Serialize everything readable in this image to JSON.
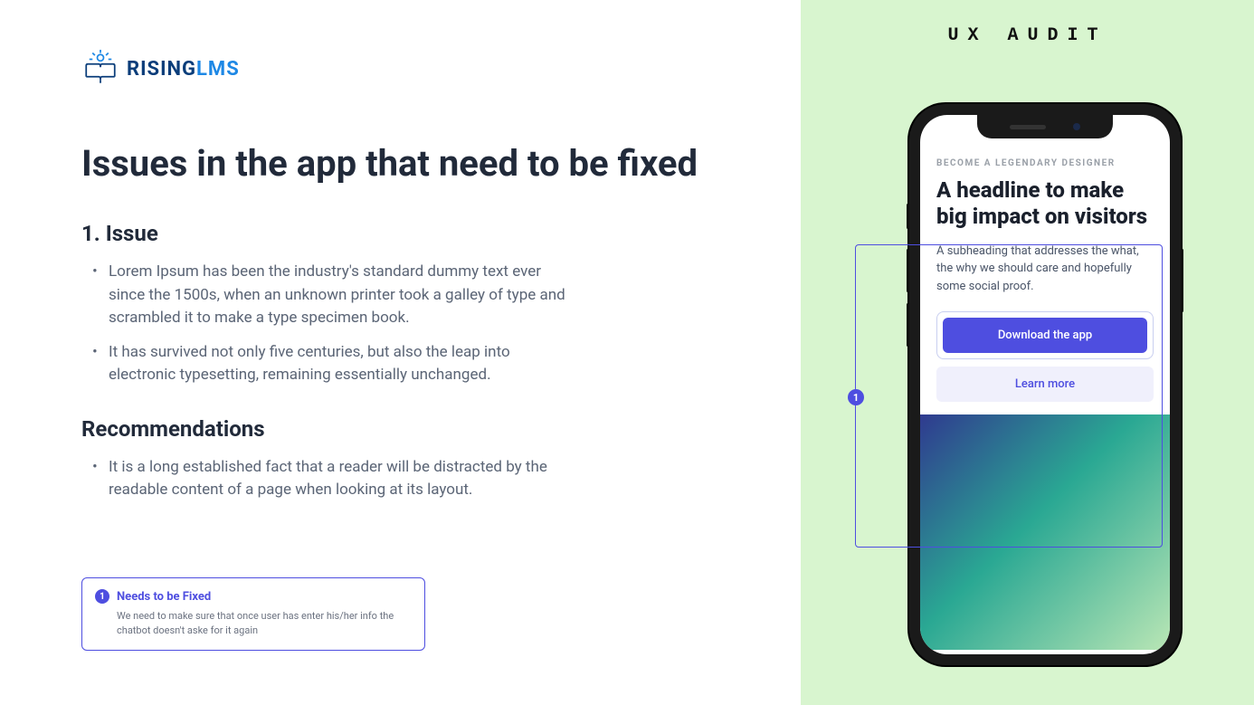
{
  "logo": {
    "rising": "RISING",
    "lms": "LMS"
  },
  "main_title": "Issues in the app that need to be fixed",
  "issue": {
    "title": "1. Issue",
    "bullets": [
      "Lorem Ipsum has been the industry's standard dummy text ever since the 1500s, when an unknown printer took a galley of type and scrambled it to make a type specimen book.",
      "It has survived not only five centuries, but also the leap into electronic typesetting, remaining essentially unchanged."
    ]
  },
  "recommendations": {
    "title": "Recommendations",
    "bullets": [
      "It is a long established fact that a reader will be distracted by the readable content of a page when looking at its layout."
    ]
  },
  "callout": {
    "number": "1",
    "title": "Needs to be Fixed",
    "body": "We need to make sure that once user has enter his/her info the chatbot doesn't aske for it again"
  },
  "right": {
    "label": "UX AUDIT",
    "annotation_number": "1"
  },
  "phone": {
    "eyebrow": "BECOME A LEGENDARY DESIGNER",
    "headline": "A headline to make big impact on visitors",
    "subheading": "A subheading that addresses the what, the why we should care and hopefully some social proof.",
    "primary_cta": "Download the app",
    "secondary_cta": "Learn more"
  },
  "colors": {
    "accent": "#4e4ee0",
    "right_bg": "#d8f5cf"
  }
}
